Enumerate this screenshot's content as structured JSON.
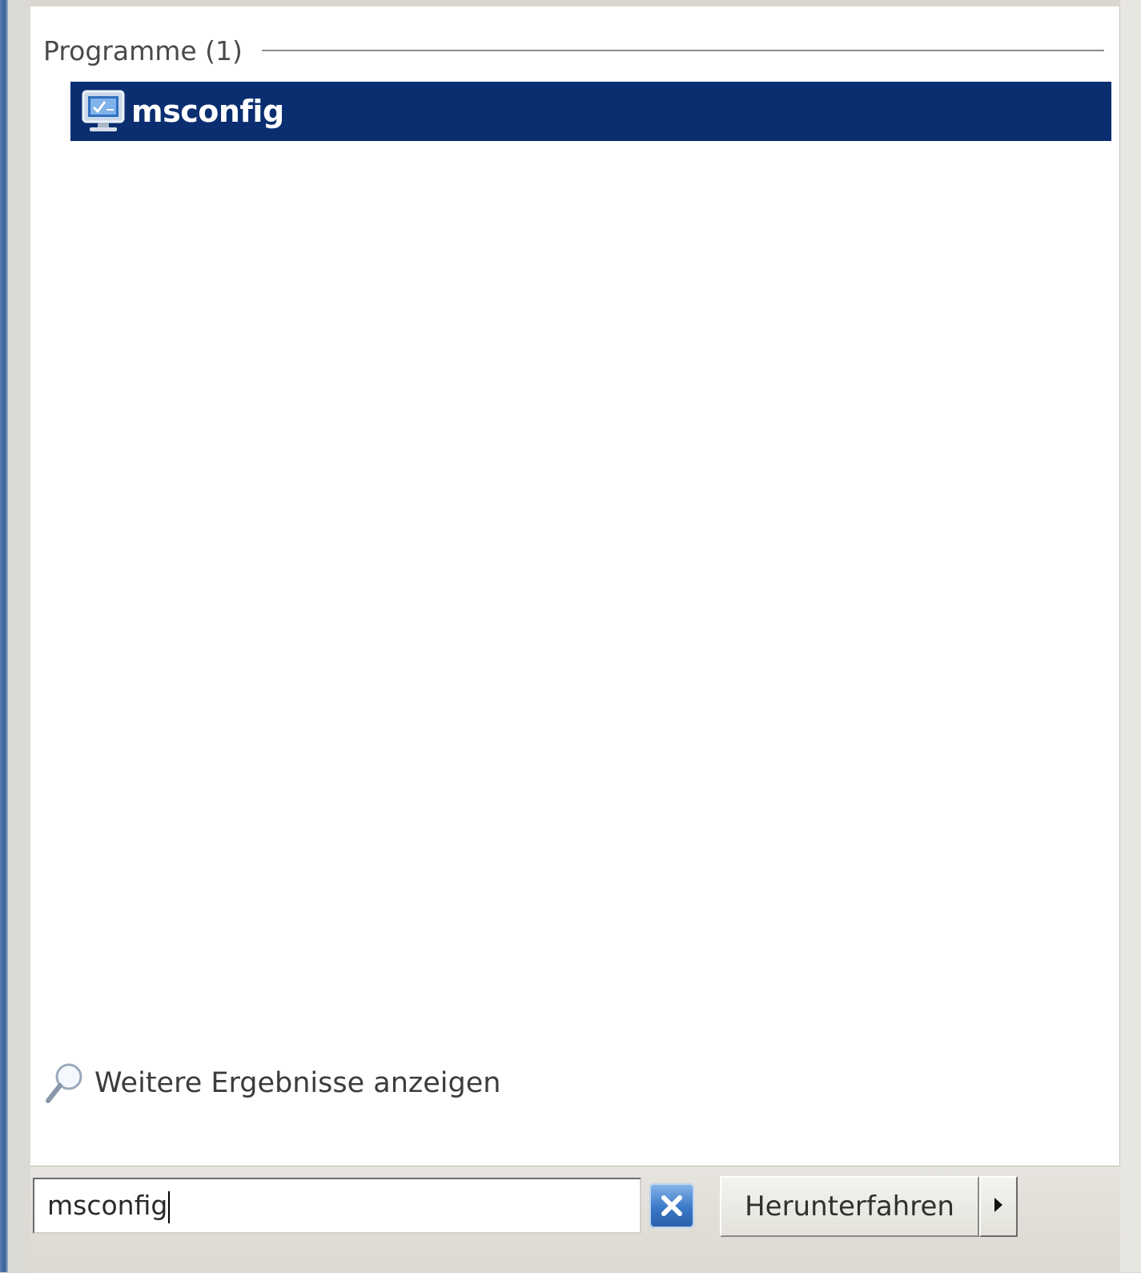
{
  "results": {
    "section_title": "Programme (1)",
    "items": [
      {
        "label": "msconfig",
        "icon": "system-configuration-icon",
        "selected": true
      }
    ]
  },
  "more_results": {
    "label": "Weitere Ergebnisse anzeigen",
    "icon": "magnifier-icon"
  },
  "search": {
    "value": "msconfig"
  },
  "actions": {
    "clear_icon": "clear-x-icon",
    "shutdown_label": "Herunterfahren",
    "shutdown_options_icon": "triangle-right-icon"
  },
  "colors": {
    "selection": "#0b2e70",
    "clear_button": "#3a78c8",
    "start_menu_edge": "#3a5f96"
  }
}
